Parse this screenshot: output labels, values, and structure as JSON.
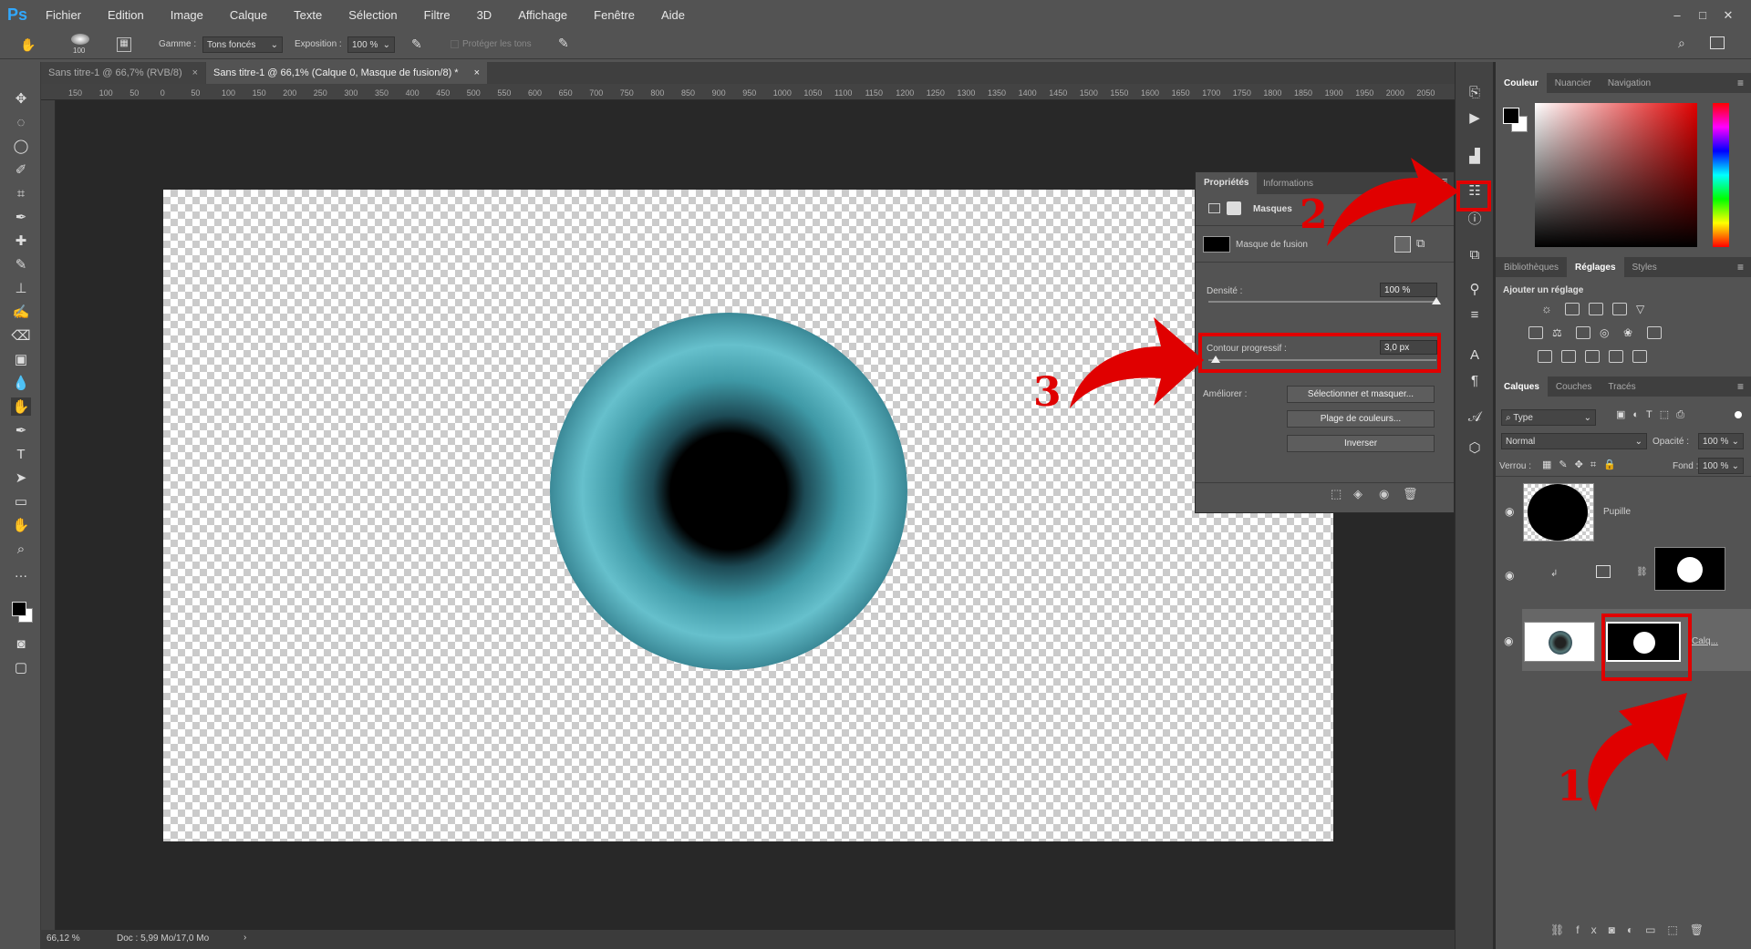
{
  "app_logo": "Ps",
  "menu": [
    "Fichier",
    "Edition",
    "Image",
    "Calque",
    "Texte",
    "Sélection",
    "Filtre",
    "3D",
    "Affichage",
    "Fenêtre",
    "Aide"
  ],
  "window_controls": [
    "–",
    "□",
    "✕"
  ],
  "options": {
    "brush_size": "100",
    "range_label": "Gamme :",
    "range_value": "Tons foncés",
    "exposure_label": "Exposition :",
    "exposure_value": "100 %",
    "protect_label": "Protéger les tons"
  },
  "tabs": [
    {
      "label": "Sans titre-1 @ 66,7% (RVB/8)",
      "active": false
    },
    {
      "label": "Sans titre-1 @ 66,1% (Calque 0, Masque de fusion/8) *",
      "active": true
    }
  ],
  "ruler_labels": [
    "150",
    "100",
    "50",
    "0",
    "50",
    "100",
    "150",
    "200",
    "250",
    "300",
    "350",
    "400",
    "450",
    "500",
    "550",
    "600",
    "650",
    "700",
    "750",
    "800",
    "850",
    "900",
    "950",
    "1000",
    "1050",
    "1100",
    "1150",
    "1200",
    "1250",
    "1300",
    "1350",
    "1400",
    "1450",
    "1500",
    "1550",
    "1600",
    "1650",
    "1700",
    "1750",
    "1800",
    "1850",
    "1900",
    "1950",
    "2000",
    "2050"
  ],
  "status": {
    "zoom": "66,12 %",
    "doc": "Doc : 5,99 Mo/17,0 Mo"
  },
  "properties": {
    "tabs": [
      "Propriétés",
      "Informations"
    ],
    "section": "Masques",
    "mask_type": "Masque de fusion",
    "density_label": "Densité :",
    "density_value": "100 %",
    "density": 1.0,
    "feather_label": "Contour progressif :",
    "feather_value": "3,0 px",
    "feather": 0.03,
    "refine_label": "Améliorer :",
    "buttons": [
      "Sélectionner et masquer...",
      "Plage de couleurs...",
      "Inverser"
    ]
  },
  "color_panel": {
    "tabs": [
      "Couleur",
      "Nuancier",
      "Navigation"
    ],
    "foreground": "#000000",
    "background": "#ffffff"
  },
  "adjustments_panel": {
    "tabs": [
      "Bibliothèques",
      "Réglages",
      "Styles"
    ],
    "heading": "Ajouter un réglage"
  },
  "layers_panel": {
    "tabs": [
      "Calques",
      "Couches",
      "Tracés"
    ],
    "filter": "Type",
    "blend_mode": "Normal",
    "opacity_label": "Opacité :",
    "opacity_value": "100 %",
    "lock_label": "Verrou :",
    "fill_label": "Fond :",
    "fill_value": "100 %",
    "layers": [
      {
        "name": "Pupille"
      },
      {
        "name": ""
      },
      {
        "name": "Calq..."
      }
    ]
  },
  "annotations": [
    "1",
    "2",
    "3"
  ],
  "colors": {
    "accent_red": "#e00000",
    "ps_blue": "#31a8ff",
    "iris": "#3f99a6"
  }
}
